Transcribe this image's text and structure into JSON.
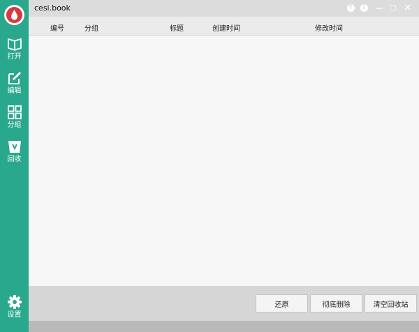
{
  "window": {
    "title": "cesi.book"
  },
  "titlebar_buttons": [
    {
      "name": "help-button",
      "glyph": "?"
    },
    {
      "name": "info-button",
      "glyph": "i"
    },
    {
      "name": "minimize-button",
      "glyph": "—"
    },
    {
      "name": "maximize-button",
      "glyph": "☐"
    },
    {
      "name": "close-button",
      "glyph": "✕"
    }
  ],
  "sidebar": {
    "logo_icon": "blood-drop-logo",
    "items": [
      {
        "label": "打开",
        "icon": "book-open-icon"
      },
      {
        "label": "编辑",
        "icon": "edit-icon"
      },
      {
        "label": "分组",
        "icon": "grid-icon"
      },
      {
        "label": "回收",
        "icon": "recycle-bin-icon"
      }
    ],
    "settings": {
      "label": "设置",
      "icon": "gear-icon"
    }
  },
  "table": {
    "columns": [
      "编号",
      "分组",
      "标题",
      "创建时间",
      "修改时间"
    ],
    "rows": []
  },
  "footer": {
    "restore": "还原",
    "delete_permanently": "彻底删除",
    "empty_bin": "清空回收站"
  },
  "colors": {
    "sidebar": "#2aa88d",
    "logo_red": "#d9383f",
    "titlebar": "#dcdcdc",
    "footer": "#d6d6d6"
  }
}
